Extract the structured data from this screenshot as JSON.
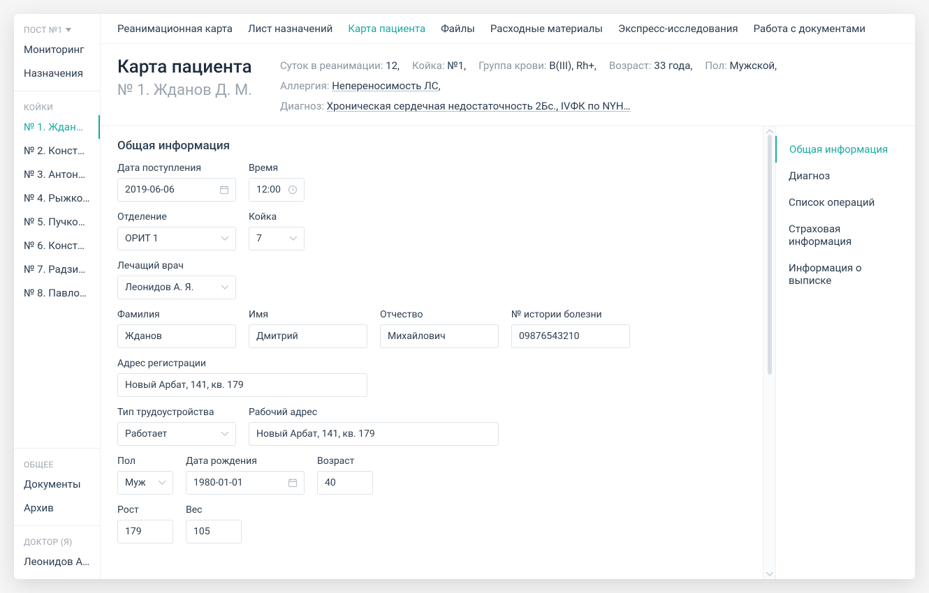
{
  "sidebar": {
    "post_label": "ПОСТ №1",
    "main_items": [
      "Мониторинг",
      "Назначения"
    ],
    "beds_header": "КОЙКИ",
    "beds": [
      "№ 1. Ждано …",
      "№ 2. Конста…",
      "№ 3. Антоне…",
      "№ 4. Рыжко…",
      "№ 5. Пучков…",
      "№ 6. Конста…",
      "№ 7. Радзих…",
      "№ 8. Павлов…"
    ],
    "general_header": "ОБЩЕЕ",
    "general_items": [
      "Документы",
      "Архив"
    ],
    "doctor_header": "ДОКТОР (Я)",
    "doctor_name": "Леонидов А. …"
  },
  "tabs": [
    "Реанимационная карта",
    "Лист назначений",
    "Карта пациента",
    "Файлы",
    "Расходные материалы",
    "Экспресс-исследования",
    "Работа с документами"
  ],
  "tabs_active_index": 2,
  "header": {
    "title": "Карта пациента",
    "subtitle": "№ 1. Жданов Д. М.",
    "meta": {
      "days_label": "Суток в реанимации:",
      "days": "12",
      "bed_label": "Койка:",
      "bed": "№1",
      "blood_label": "Группа крови:",
      "blood": "B(III), Rh+",
      "age_label": "Возраст:",
      "age": "33 года",
      "sex_label": "Пол:",
      "sex": "Мужской",
      "allergy_label": "Аллергия:",
      "allergy": "Непереносимость ЛС",
      "diagnosis_label": "Диагноз:",
      "diagnosis": "Хроническая сердечная недостаточность 2Бс., IVФК по NYH…"
    }
  },
  "form": {
    "section_title": "Общая информация",
    "labels": {
      "admit_date": "Дата поступления",
      "time": "Время",
      "department": "Отделение",
      "bed": "Койка",
      "doctor": "Лечащий врач",
      "lastname": "Фамилия",
      "firstname": "Имя",
      "patronymic": "Отчество",
      "history_no": "№ истории болезни",
      "reg_address": "Адрес регистрации",
      "employment": "Тип трудоустройства",
      "work_address": "Рабочий адрес",
      "sex": "Пол",
      "dob": "Дата рождения",
      "age": "Возраст",
      "height": "Рост",
      "weight": "Вес"
    },
    "values": {
      "admit_date": "2019-06-06",
      "time": "12:00",
      "department": "ОРИТ 1",
      "bed": "7",
      "doctor": "Леонидов А. Я.",
      "lastname": "Жданов",
      "firstname": "Дмитрий",
      "patronymic": "Михайлович",
      "history_no": "09876543210",
      "reg_address": "Новый Арбат, 141, кв. 179",
      "employment": "Работает",
      "work_address": "Новый Арбат, 141, кв. 179",
      "sex": "Муж",
      "dob": "1980-01-01",
      "age": "40",
      "height": "179",
      "weight": "105"
    }
  },
  "anchor": [
    "Общая информация",
    "Диагноз",
    "Список операций",
    "Страховая информация",
    "Информация о выписке"
  ],
  "anchor_active_index": 0
}
